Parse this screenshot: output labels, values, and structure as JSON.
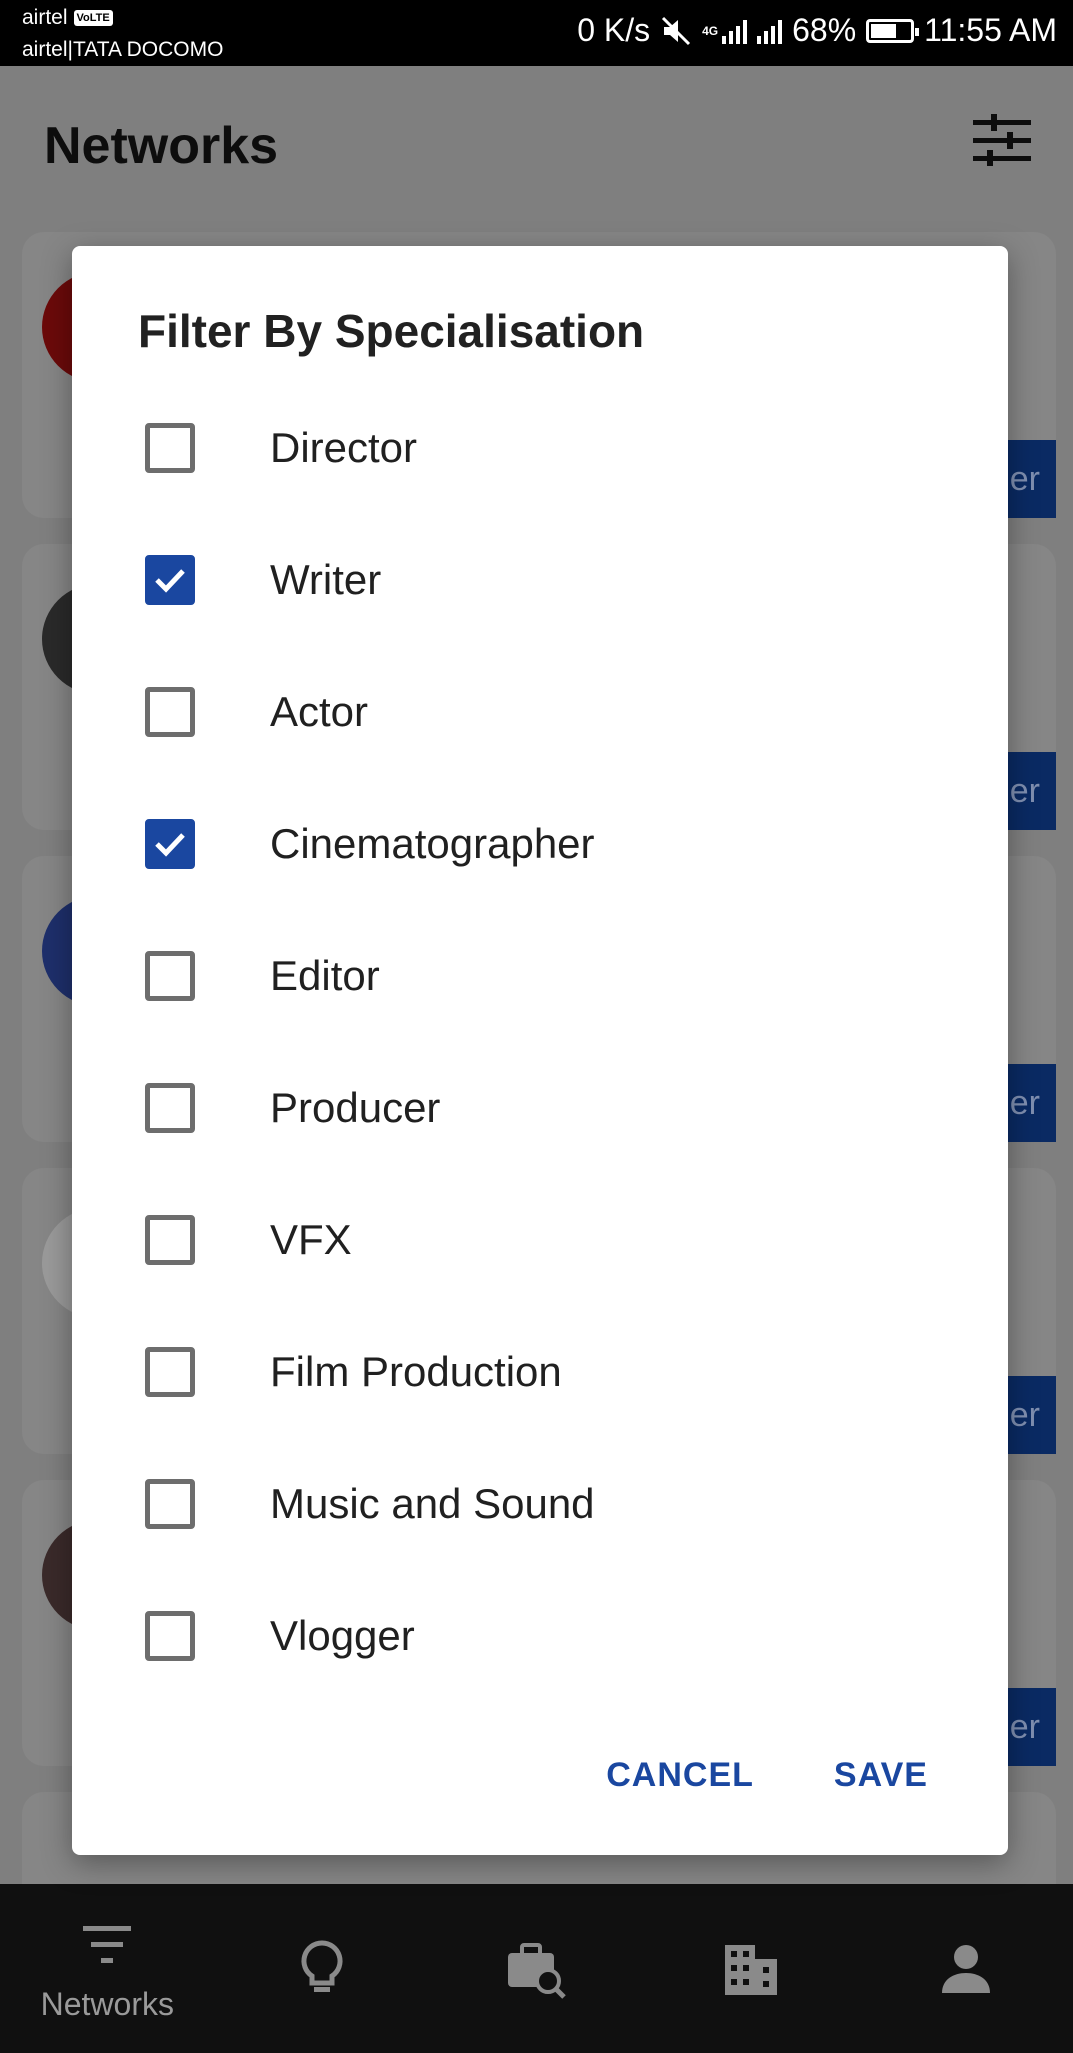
{
  "status_bar": {
    "carrier1": "airtel",
    "volte": "VoLTE",
    "carrier2": "airtel|TATA DOCOMO",
    "speed": "0 K/s",
    "network_type": "4G",
    "battery": "68%",
    "time": "11:55 AM"
  },
  "app": {
    "title": "Networks",
    "card_button_suffix": "er"
  },
  "dialog": {
    "title": "Filter By Specialisation",
    "options": [
      {
        "label": "Director",
        "checked": false
      },
      {
        "label": "Writer",
        "checked": true
      },
      {
        "label": "Actor",
        "checked": false
      },
      {
        "label": "Cinematographer",
        "checked": true
      },
      {
        "label": "Editor",
        "checked": false
      },
      {
        "label": "Producer",
        "checked": false
      },
      {
        "label": "VFX",
        "checked": false
      },
      {
        "label": "Film Production",
        "checked": false
      },
      {
        "label": "Music and Sound",
        "checked": false
      },
      {
        "label": "Vlogger",
        "checked": false
      }
    ],
    "cancel_label": "CANCEL",
    "save_label": "SAVE"
  },
  "bottom_nav": {
    "items": [
      {
        "icon": "filter-list-icon",
        "label": "Networks"
      },
      {
        "icon": "lightbulb-icon",
        "label": ""
      },
      {
        "icon": "job-search-icon",
        "label": ""
      },
      {
        "icon": "building-icon",
        "label": ""
      },
      {
        "icon": "person-icon",
        "label": ""
      }
    ]
  },
  "colors": {
    "accent": "#1a47a0",
    "checkbox_unchecked": "#6d6d6d",
    "nav_background": "#101010"
  }
}
